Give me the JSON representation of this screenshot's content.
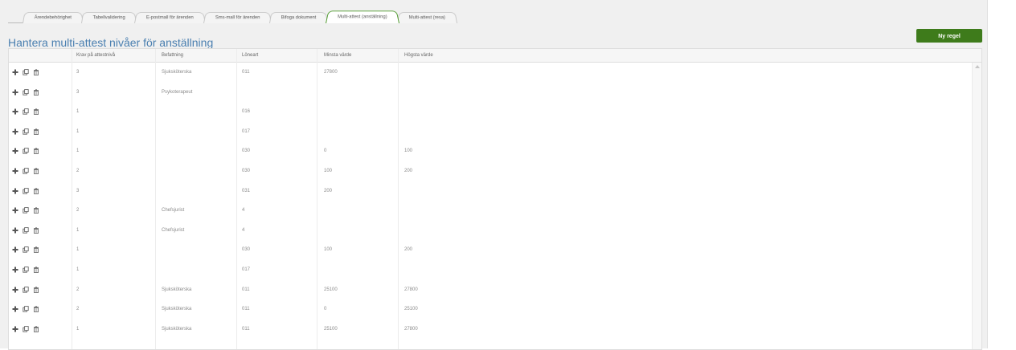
{
  "tabs": [
    {
      "label": "Ärendebehörighet",
      "active": false
    },
    {
      "label": "Tabellvalidering",
      "active": false
    },
    {
      "label": "E-postmall för ärenden",
      "active": false
    },
    {
      "label": "Sms-mall för ärenden",
      "active": false
    },
    {
      "label": "Bifoga dokument",
      "active": false
    },
    {
      "label": "Multi-attest (anställning)",
      "active": true
    },
    {
      "label": "Multi-attest (resa)",
      "active": false
    }
  ],
  "page": {
    "title": "Hantera multi-attest nivåer för anställning",
    "new_button_label": "Ny regel"
  },
  "table": {
    "columns": [
      "",
      "Krav på attestnivå",
      "Befattning",
      "Löneart",
      "Minsta värde",
      "Högsta värde"
    ],
    "row_icons": [
      "plus-icon",
      "copy-icon",
      "trash-icon"
    ],
    "rows": [
      [
        "3",
        "Sjuksköterska",
        "011",
        "27800",
        ""
      ],
      [
        "3",
        "Psykoterapeut",
        "",
        "",
        ""
      ],
      [
        "1",
        "",
        "016",
        "",
        ""
      ],
      [
        "1",
        "",
        "017",
        "",
        ""
      ],
      [
        "1",
        "",
        "030",
        "0",
        "100"
      ],
      [
        "2",
        "",
        "030",
        "100",
        "200"
      ],
      [
        "3",
        "",
        "031",
        "200",
        ""
      ],
      [
        "2",
        "Chefsjurist",
        "4",
        "",
        ""
      ],
      [
        "1",
        "Chefsjurist",
        "4",
        "",
        ""
      ],
      [
        "1",
        "",
        "030",
        "100",
        "200"
      ],
      [
        "1",
        "",
        "017",
        "",
        ""
      ],
      [
        "2",
        "Sjuksköterska",
        "011",
        "25100",
        "27800"
      ],
      [
        "2",
        "Sjuksköterska",
        "011",
        "0",
        "25100"
      ],
      [
        "1",
        "Sjuksköterska",
        "011",
        "25100",
        "27800"
      ]
    ]
  },
  "colors": {
    "accent_green": "#3e7b1b",
    "active_tab_border": "#4e9a2c",
    "title_blue": "#4a7fb0"
  }
}
